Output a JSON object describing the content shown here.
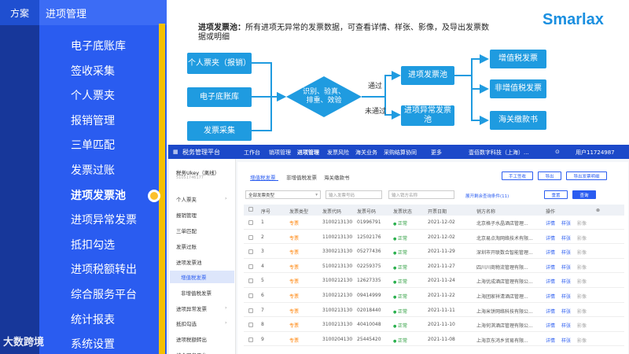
{
  "left_strip": {
    "label": "方案"
  },
  "nav": {
    "title": "进项管理",
    "items": [
      "电子底账库",
      "签收采集",
      "个人票夹",
      "报销管理",
      "三单匹配",
      "发票过账",
      "进项发票池",
      "进项异常发票",
      "抵扣勾选",
      "进项税额转出",
      "综合服务平台",
      "统计报表",
      "系统设置"
    ],
    "active_index": 6
  },
  "brand": "大数跨境",
  "logo": "Smarlax",
  "description": {
    "title": "进项发票池：",
    "text": "所有进项无异常的发票数据，可查看详情、样张、影像，及导出发票数据或明细"
  },
  "flow": {
    "sources": [
      "个人票夹（报销）",
      "电子底账库",
      "发票采集"
    ],
    "decision": "识别、验真、排重、效验",
    "pass_label": "通过",
    "fail_label": "未通过",
    "pool": "进项发票池",
    "abnormal": "进项异常发票池",
    "outputs": [
      "增值税发票",
      "非增值税发票",
      "海关缴款书"
    ]
  },
  "app": {
    "topbar": {
      "title": "税务管理平台",
      "menus": [
        "工作台",
        "销项管理",
        "进项管理",
        "发票风险",
        "海关业务",
        "采购结算协同",
        "更多"
      ],
      "company": "壹佰数字科技（上海）...",
      "user": "用户11724987"
    },
    "sidebar": {
      "account": "税务Ukey（离线）",
      "account_id": "51051746177",
      "items": [
        "个人票夹",
        "报销管理",
        "三单匹配",
        "发票过账",
        "进项发票池",
        "增值税发票",
        "非增值税发票",
        "进项异常发票",
        "抵扣勾选",
        "进项税额转出",
        "综合服务平台"
      ],
      "selected": "增值税发票"
    },
    "tabs": [
      "增值税发票",
      "非增值税发票",
      "海关缴款书"
    ],
    "buttons": {
      "manual": "手工签收",
      "export": "导出",
      "export_detail": "导出发票明细",
      "reset": "重置",
      "search": "查询"
    },
    "filters": {
      "type": "全部发票类型",
      "number": "输入发票号码",
      "seller": "输入销方名称",
      "expand": "展开剩余查询条件(11)"
    },
    "table": {
      "headers": [
        "序号",
        "发票类型",
        "发票代码",
        "发票号码",
        "发票状态",
        "开票日期",
        "销方名称",
        "操作"
      ],
      "actions": [
        "详情",
        "样张",
        "影像"
      ],
      "rows": [
        [
          "1",
          "专票",
          "3100213130",
          "01996791",
          "正常",
          "2021-12-02",
          "北京格子水晶酒店管理..."
        ],
        [
          "2",
          "专票",
          "1100213130",
          "12502176",
          "正常",
          "2021-12-02",
          "北京易点淘网络技术有限..."
        ],
        [
          "3",
          "专票",
          "3300213130",
          "05277436",
          "正常",
          "2021-11-29",
          "深圳市开联数合智能管理..."
        ],
        [
          "4",
          "专票",
          "5100213130",
          "02259375",
          "正常",
          "2021-11-27",
          "四川川商物流管理有限..."
        ],
        [
          "5",
          "专票",
          "3100212130",
          "12627335",
          "正常",
          "2021-11-24",
          "上海优成酒店管理有限公..."
        ],
        [
          "6",
          "专票",
          "3100212130",
          "09414999",
          "正常",
          "2021-11-22",
          "上海团家祥清酒店管理..."
        ],
        [
          "7",
          "专票",
          "3100213130",
          "02018440",
          "正常",
          "2021-11-11",
          "上海米饼网络科技有限公..."
        ],
        [
          "8",
          "专票",
          "3100213130",
          "40410048",
          "正常",
          "2021-11-10",
          "上海何淇酒店管理有限公..."
        ],
        [
          "9",
          "专票",
          "3100204130",
          "25445420",
          "正常",
          "2021-11-08",
          "上海京东鸿乡贸易有限..."
        ]
      ]
    }
  }
}
